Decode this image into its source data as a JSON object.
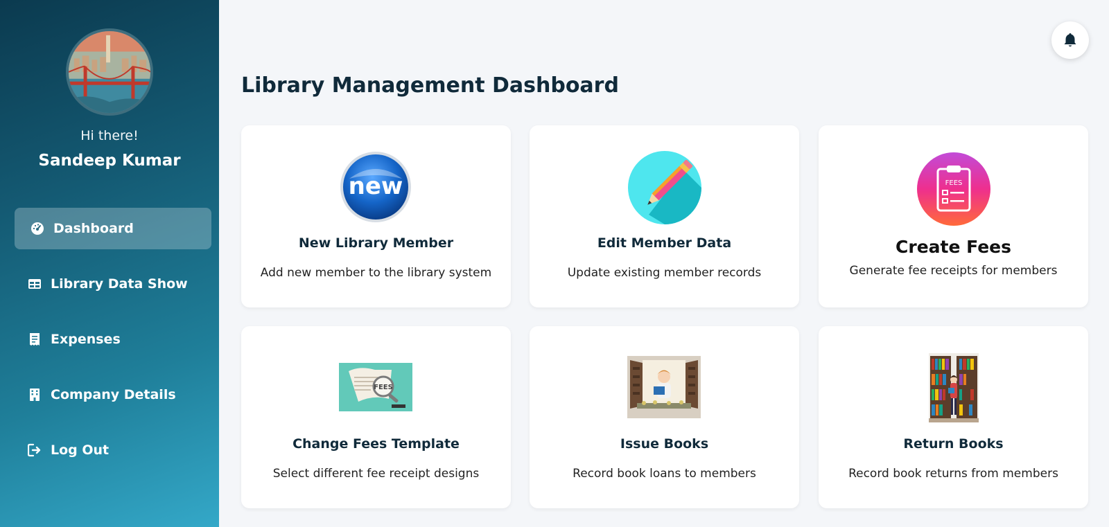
{
  "sidebar": {
    "greeting": "Hi there!",
    "user_name": "Sandeep Kumar",
    "nav": [
      {
        "label": "Dashboard",
        "icon": "gauge-icon",
        "active": true
      },
      {
        "label": "Library Data Show",
        "icon": "table-icon",
        "active": false
      },
      {
        "label": "Expenses",
        "icon": "receipt-icon",
        "active": false
      },
      {
        "label": "Company Details",
        "icon": "building-icon",
        "active": false
      },
      {
        "label": "Log Out",
        "icon": "logout-icon",
        "active": false
      }
    ]
  },
  "header": {
    "notification_icon": "bell-icon"
  },
  "main": {
    "title": "Library Management Dashboard",
    "cards": [
      {
        "title": "New Library Member",
        "description": "Add new member to the library system",
        "icon": "new-badge-icon"
      },
      {
        "title": "Edit Member Data",
        "description": "Update existing member records",
        "icon": "pencil-icon"
      },
      {
        "title": "Create Fees",
        "description": "Generate fee receipts for members",
        "icon": "fees-clipboard-icon"
      },
      {
        "title": "Change Fees Template",
        "description": "Select different fee receipt designs",
        "icon": "fees-receipt-image"
      },
      {
        "title": "Issue Books",
        "description": "Record book loans to members",
        "icon": "reading-window-image"
      },
      {
        "title": "Return Books",
        "description": "Record book returns from members",
        "icon": "bookshelf-image"
      }
    ]
  },
  "colors": {
    "sidebar_start": "#0b3a4f",
    "sidebar_end": "#34a8c8",
    "title": "#102a3a",
    "background": "#f4f6f9"
  }
}
